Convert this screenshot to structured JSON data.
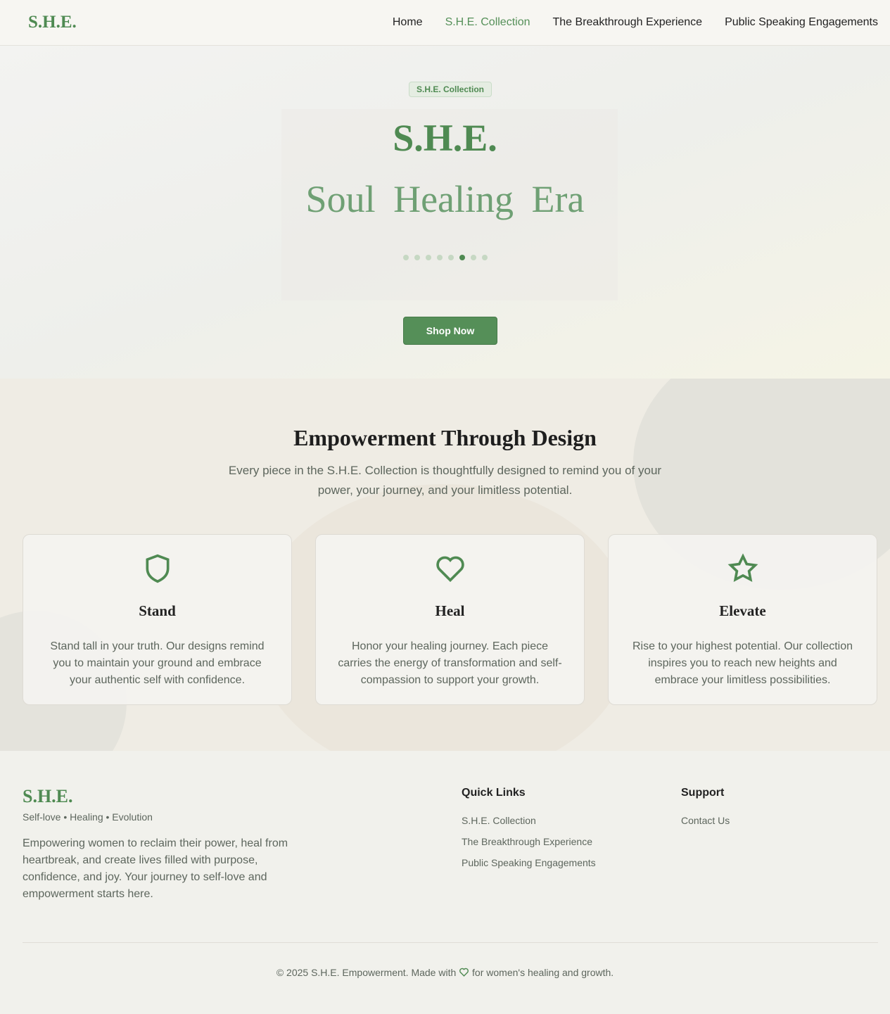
{
  "header": {
    "logo": "S.H.E.",
    "nav": [
      "Home",
      "S.H.E. Collection",
      "The Breakthrough Experience",
      "Public Speaking Engagements"
    ]
  },
  "hero": {
    "badge": "S.H.E. Collection",
    "title": "S.H.E.",
    "subtitle": "Soul  Healing  Era",
    "slides_total": 8,
    "active_slide": 6,
    "cta": "Shop Now"
  },
  "empower": {
    "title": "Empowerment Through Design",
    "lead": "Every piece in the S.H.E. Collection is thoughtfully designed to remind you of your power, your journey, and your limitless potential.",
    "cards": [
      {
        "icon": "shield-icon",
        "title": "Stand",
        "text": "Stand tall in your truth. Our designs remind you to maintain your ground and embrace your authentic self with confidence."
      },
      {
        "icon": "heart-icon",
        "title": "Heal",
        "text": "Honor your healing journey. Each piece carries the energy of transformation and self-compassion to support your growth."
      },
      {
        "icon": "star-icon",
        "title": "Elevate",
        "text": "Rise to your highest potential. Our collection inspires you to reach new heights and embrace your limitless possibilities."
      }
    ]
  },
  "footer": {
    "logo": "S.H.E.",
    "tagline": "Self-love • Healing • Evolution",
    "description": "Empowering women to reclaim their power, heal from heartbreak, and create lives filled with purpose, confidence, and joy. Your journey to self-love and empowerment starts here.",
    "quick_links_title": "Quick Links",
    "quick_links": [
      "S.H.E. Collection",
      "The Breakthrough Experience",
      "Public Speaking Engagements"
    ],
    "support_title": "Support",
    "support_links": [
      "Contact Us"
    ],
    "copyright_before": "© 2025 S.H.E. Empowerment. Made with",
    "copyright_after": "for women's healing and growth."
  },
  "colors": {
    "accent": "#4f8a52"
  }
}
